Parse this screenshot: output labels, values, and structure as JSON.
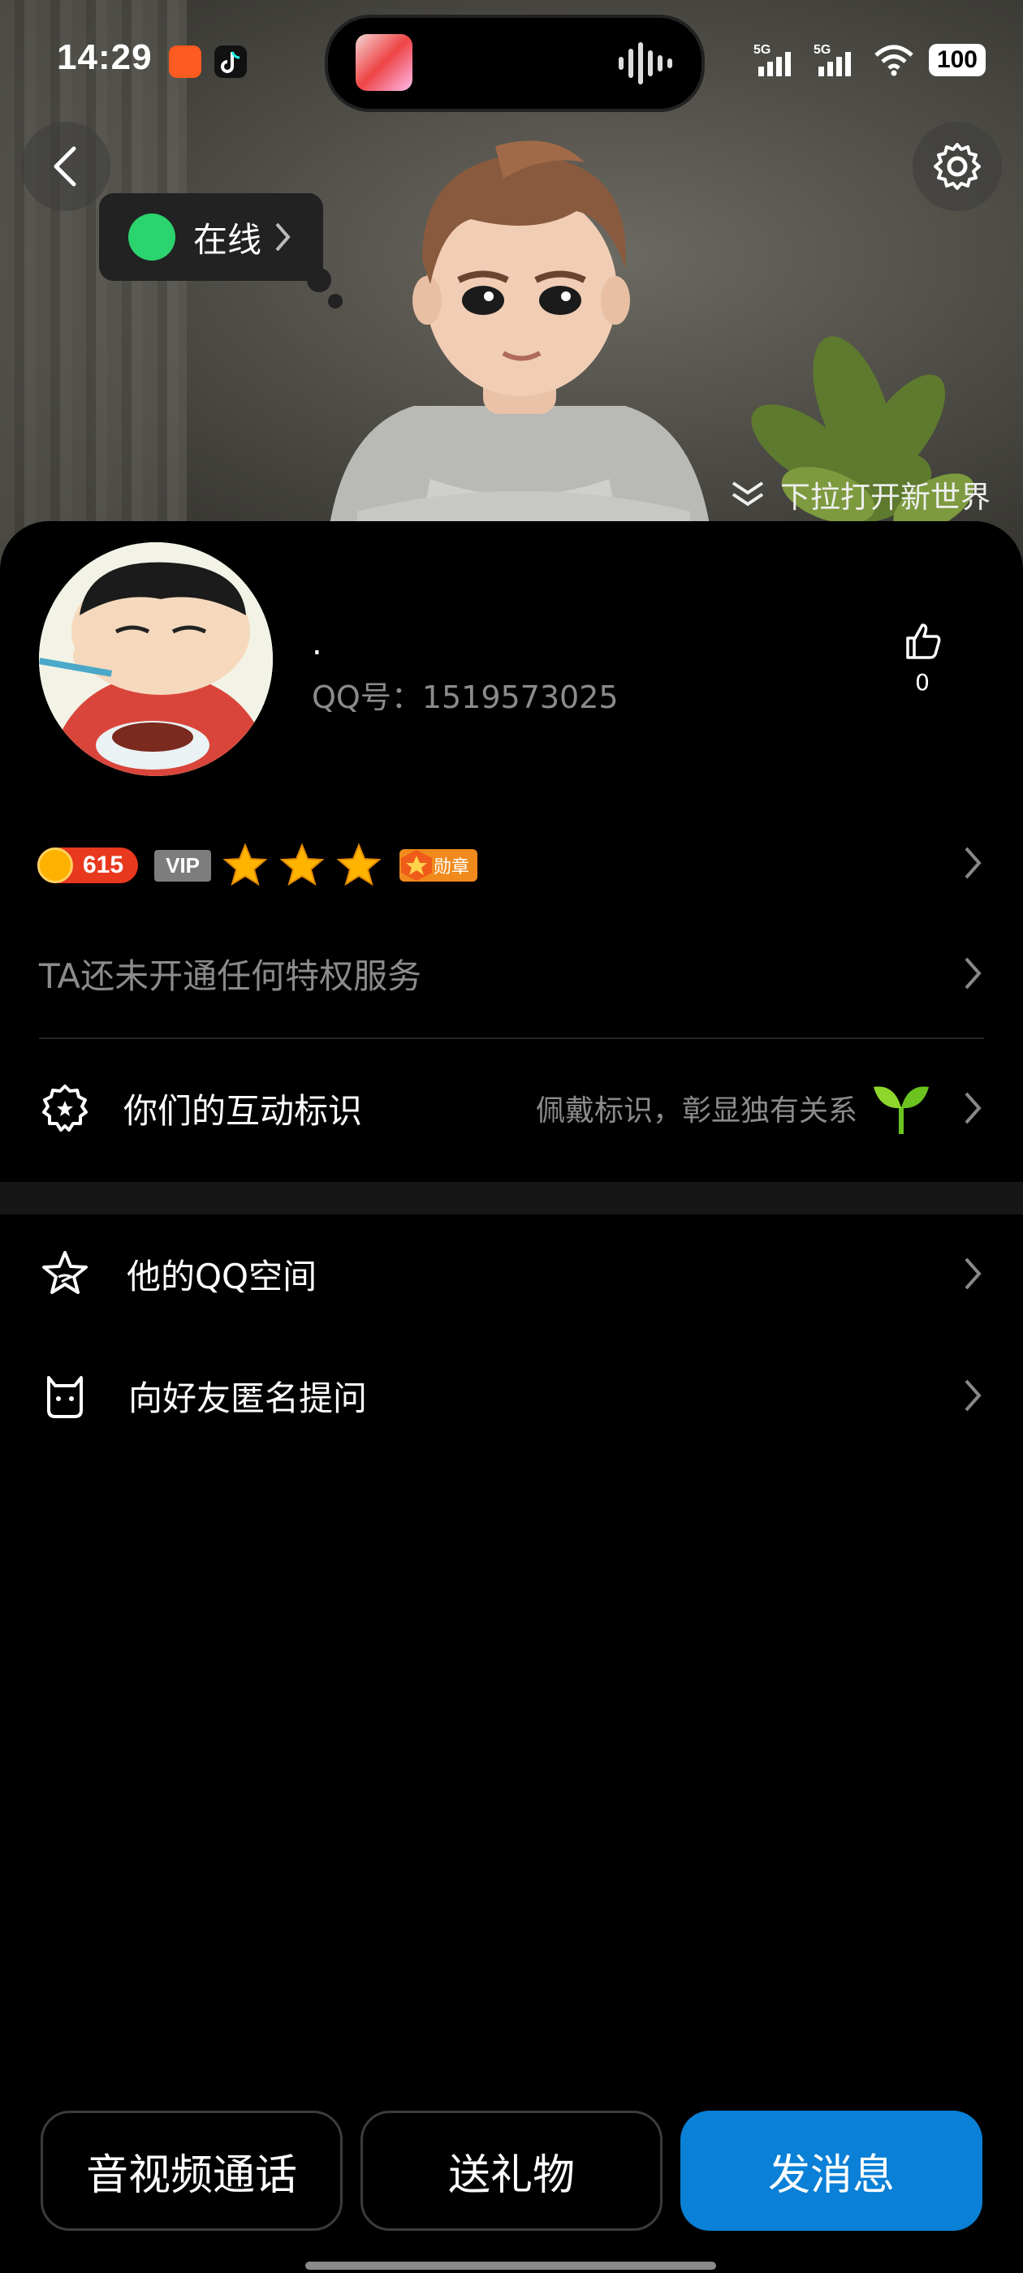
{
  "status_bar": {
    "time": "14:29",
    "battery": "100",
    "signal1_label": "5G",
    "signal2_label": "5G"
  },
  "hero": {
    "online_status": "在线",
    "pull_hint": "下拉打开新世界"
  },
  "profile": {
    "nickname": ".",
    "qq_number": "QQ号：1519573025",
    "like_count": "0"
  },
  "badges": {
    "level": "615",
    "vip": "VIP",
    "star_count": 3,
    "medal_label": "勋章"
  },
  "rows": {
    "privilege": "TA还未开通任何特权服务",
    "interaction_label": "你们的互动标识",
    "interaction_hint": "佩戴标识，彰显独有关系",
    "qzone": "他的QQ空间",
    "anon_question": "向好友匿名提问"
  },
  "actions": {
    "call": "音视频通话",
    "gift": "送礼物",
    "message": "发消息"
  },
  "colors": {
    "accent": "#0a80d6",
    "online": "#2bd46e",
    "level": "#e8391f"
  }
}
